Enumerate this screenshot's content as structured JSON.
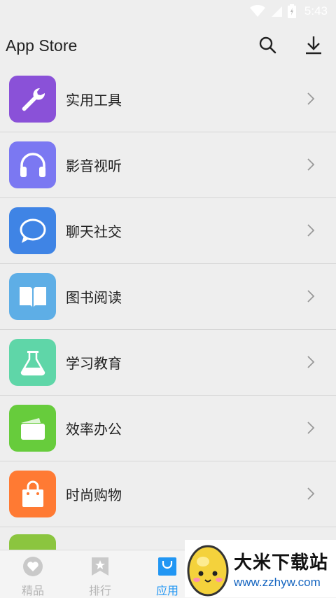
{
  "status_bar": {
    "time": "5:43"
  },
  "app_bar": {
    "title": "App Store"
  },
  "categories": [
    {
      "label": "实用工具",
      "color": "#8a51d8",
      "icon": "wrench-icon"
    },
    {
      "label": "影音视听",
      "color": "#7b78f2",
      "icon": "headphones-icon"
    },
    {
      "label": "聊天社交",
      "color": "#3f84e5",
      "icon": "chat-bubble-icon"
    },
    {
      "label": "图书阅读",
      "color": "#5eaee6",
      "icon": "open-book-icon"
    },
    {
      "label": "学习教育",
      "color": "#5fd6a8",
      "icon": "flask-icon"
    },
    {
      "label": "效率办公",
      "color": "#67cc3c",
      "icon": "wallet-icon"
    },
    {
      "label": "时尚购物",
      "color": "#ff7a33",
      "icon": "shopping-bag-icon"
    }
  ],
  "bottom_nav": {
    "items": [
      {
        "label": "精品",
        "active": false
      },
      {
        "label": "排行",
        "active": false
      },
      {
        "label": "应用",
        "active": true
      }
    ],
    "active_color": "#2196f3",
    "inactive_color": "#b5b5b5"
  },
  "watermark": {
    "title": "大米下载站",
    "url": "www.zzhyw.com"
  }
}
